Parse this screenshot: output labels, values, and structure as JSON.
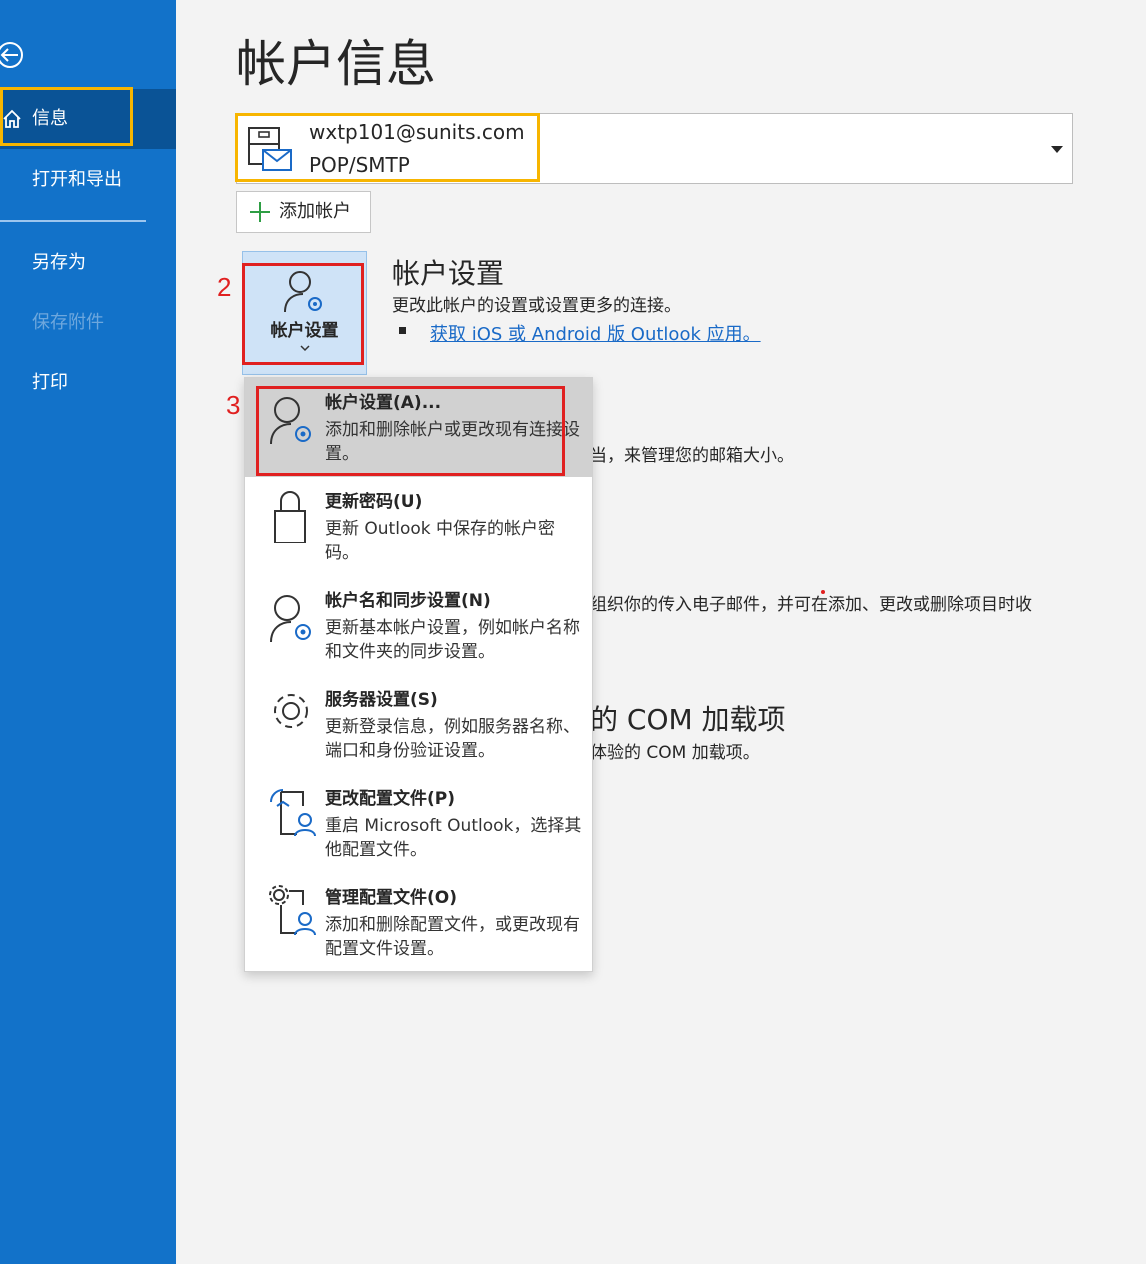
{
  "sidebar": {
    "items": [
      {
        "label": "信息",
        "active": true
      },
      {
        "label": "打开和导出"
      },
      {
        "label": "另存为"
      },
      {
        "label": "保存附件",
        "disabled": true
      },
      {
        "label": "打印"
      }
    ]
  },
  "page": {
    "title": "帐户信息"
  },
  "account": {
    "email": "wxtp101@sunits.com",
    "type": "POP/SMTP"
  },
  "add_account": {
    "label": "添加帐户"
  },
  "account_settings": {
    "button_label": "帐户设置",
    "title": "帐户设置",
    "description": "更改此帐户的设置或设置更多的连接。",
    "link": "获取 iOS 或 Android 版 Outlook 应用。"
  },
  "background_text": {
    "mailbox": "当，来管理您的邮箱大小。",
    "rules": "组织你的传入电子邮件，并可在添加、更改或删除项目时收",
    "com_heading": "的 COM 加载项",
    "com_desc": "体验的 COM 加载项。"
  },
  "annotations": {
    "step2": "2",
    "step3": "3"
  },
  "menu": {
    "items": [
      {
        "title": "帐户设置(A)...",
        "description": "添加和删除帐户或更改现有连接设置。",
        "icon": "account-settings-icon"
      },
      {
        "title": "更新密码(U)",
        "description": "更新 Outlook 中保存的帐户密码。",
        "icon": "lock-icon"
      },
      {
        "title": "帐户名和同步设置(N)",
        "description": "更新基本帐户设置，例如帐户名称和文件夹的同步设置。",
        "icon": "account-sync-icon"
      },
      {
        "title": "服务器设置(S)",
        "description": "更新登录信息，例如服务器名称、端口和身份验证设置。",
        "icon": "gear-icon"
      },
      {
        "title": "更改配置文件(P)",
        "description": "重启 Microsoft Outlook，选择其他配置文件。",
        "icon": "change-profile-icon"
      },
      {
        "title": "管理配置文件(O)",
        "description": "添加和删除配置文件，或更改现有配置文件设置。",
        "icon": "manage-profile-icon"
      }
    ]
  },
  "colors": {
    "sidebar": "#1272c9",
    "sidebar_active": "#0a5396",
    "highlight_yellow": "#f7b500",
    "annotation_red": "#e02020",
    "link": "#1a6ac7"
  }
}
